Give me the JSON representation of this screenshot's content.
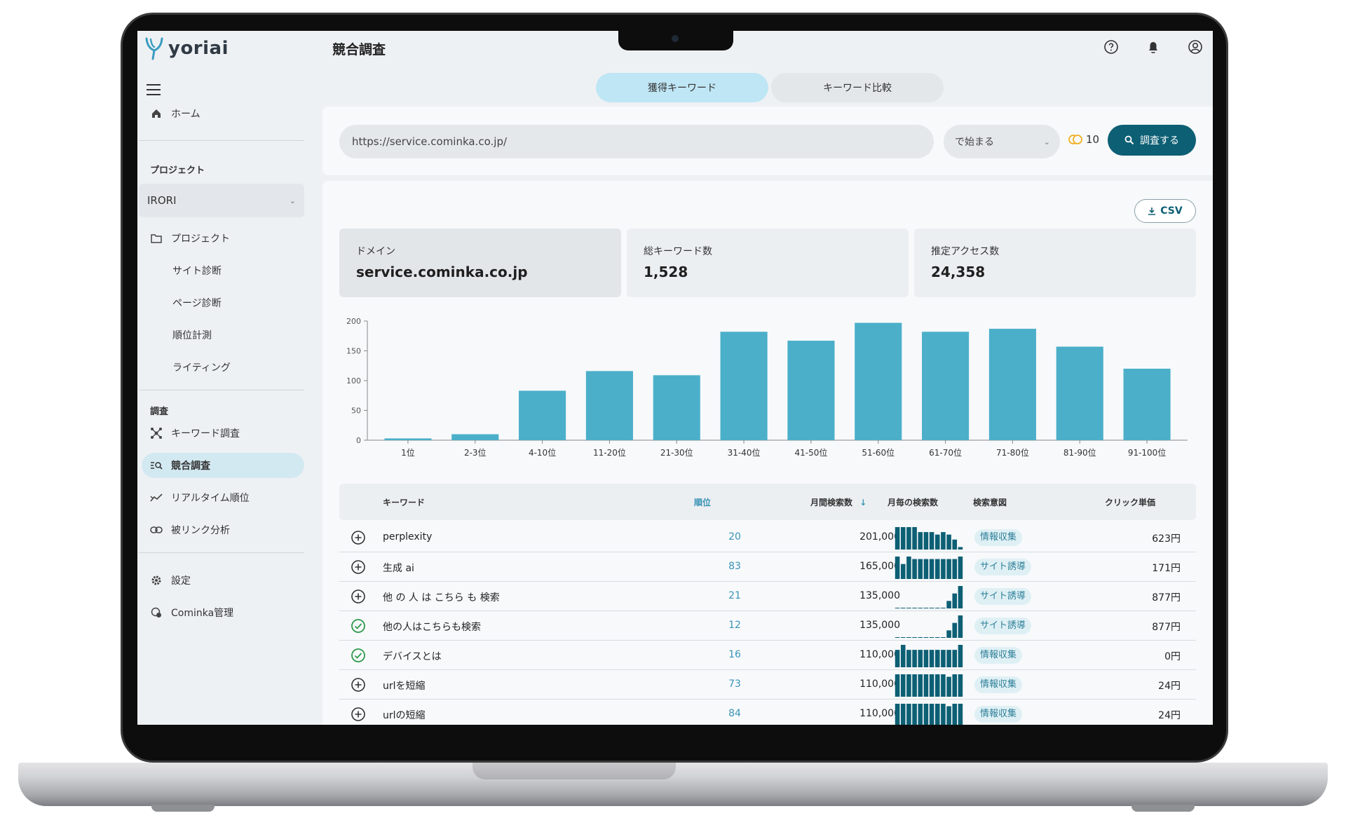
{
  "app": {
    "logo_text": "yoriai",
    "page_title": "競合調査"
  },
  "sidebar": {
    "home": "ホーム",
    "project_section": "プロジェクト",
    "project_select": "IRORI",
    "project_items": [
      "プロジェクト",
      "サイト診断",
      "ページ診断",
      "順位計測",
      "ライティング"
    ],
    "research_section": "調査",
    "research_items": [
      "キーワード調査",
      "競合調査",
      "リアルタイム順位",
      "被リンク分析"
    ],
    "settings": "設定",
    "admin": "Cominka管理"
  },
  "tabs": [
    "獲得キーワード",
    "キーワード比較"
  ],
  "search": {
    "url_value": "https://service.cominka.co.jp/",
    "match_option": "で始まる",
    "credits": "10",
    "button": "調査する"
  },
  "csv_button": "CSV",
  "stats": [
    {
      "label": "ドメイン",
      "value": "service.cominka.co.jp"
    },
    {
      "label": "総キーワード数",
      "value": "1,528"
    },
    {
      "label": "推定アクセス数",
      "value": "24,358"
    }
  ],
  "chart_data": {
    "type": "bar",
    "categories": [
      "1位",
      "2-3位",
      "4-10位",
      "11-20位",
      "21-30位",
      "31-40位",
      "41-50位",
      "51-60位",
      "61-70位",
      "71-80位",
      "81-90位",
      "91-100位"
    ],
    "values": [
      3,
      10,
      83,
      116,
      109,
      182,
      167,
      197,
      182,
      187,
      157,
      120
    ],
    "ylim": [
      0,
      200
    ],
    "yticks": [
      0,
      50,
      100,
      150,
      200
    ],
    "color": "#4bafc9"
  },
  "table": {
    "headers": {
      "keyword": "キーワード",
      "rank": "順位",
      "volume": "月間検索数",
      "monthly": "月毎の検索数",
      "intent": "検索意図",
      "cpc": "クリック単価"
    },
    "rows": [
      {
        "status": "add",
        "keyword": "perplexity",
        "rank": "20",
        "volume": "201,000",
        "trend": [
          9,
          9,
          9,
          9,
          7,
          7,
          7,
          6,
          7,
          6,
          4,
          1
        ],
        "intent": "情報収集",
        "cpc": "623円"
      },
      {
        "status": "add",
        "keyword": "生成 ai",
        "rank": "83",
        "volume": "165,000",
        "trend": [
          9,
          6,
          9,
          8,
          8,
          8,
          8,
          8,
          8,
          8,
          8,
          9
        ],
        "intent": "サイト誘導",
        "cpc": "171円"
      },
      {
        "status": "add",
        "keyword": "他 の 人 は こちら も 検索",
        "rank": "21",
        "volume": "135,000",
        "trend": [
          0.2,
          0.2,
          0.2,
          0.2,
          0.2,
          0.2,
          0.2,
          0.2,
          0.2,
          3,
          6,
          9
        ],
        "intent": "サイト誘導",
        "cpc": "877円"
      },
      {
        "status": "done",
        "keyword": "他の人はこちらも検索",
        "rank": "12",
        "volume": "135,000",
        "trend": [
          0.2,
          0.2,
          0.2,
          0.2,
          0.2,
          0.2,
          0.2,
          0.2,
          0.2,
          3,
          6,
          9
        ],
        "intent": "サイト誘導",
        "cpc": "877円"
      },
      {
        "status": "done",
        "keyword": "デバイスとは",
        "rank": "16",
        "volume": "110,000",
        "trend": [
          7,
          9,
          7,
          7,
          7,
          7,
          7,
          7,
          7,
          7,
          7,
          9
        ],
        "intent": "情報収集",
        "cpc": "0円"
      },
      {
        "status": "add",
        "keyword": "urlを短縮",
        "rank": "73",
        "volume": "110,000",
        "trend": [
          9,
          9,
          9,
          9,
          9,
          9,
          9,
          9,
          9,
          8,
          9,
          9
        ],
        "intent": "情報収集",
        "cpc": "24円"
      },
      {
        "status": "add",
        "keyword": "urlの短縮",
        "rank": "84",
        "volume": "110,000",
        "trend": [
          9,
          9,
          9,
          9,
          9,
          9,
          9,
          9,
          9,
          8,
          9,
          9
        ],
        "intent": "情報収集",
        "cpc": "24円"
      }
    ]
  }
}
